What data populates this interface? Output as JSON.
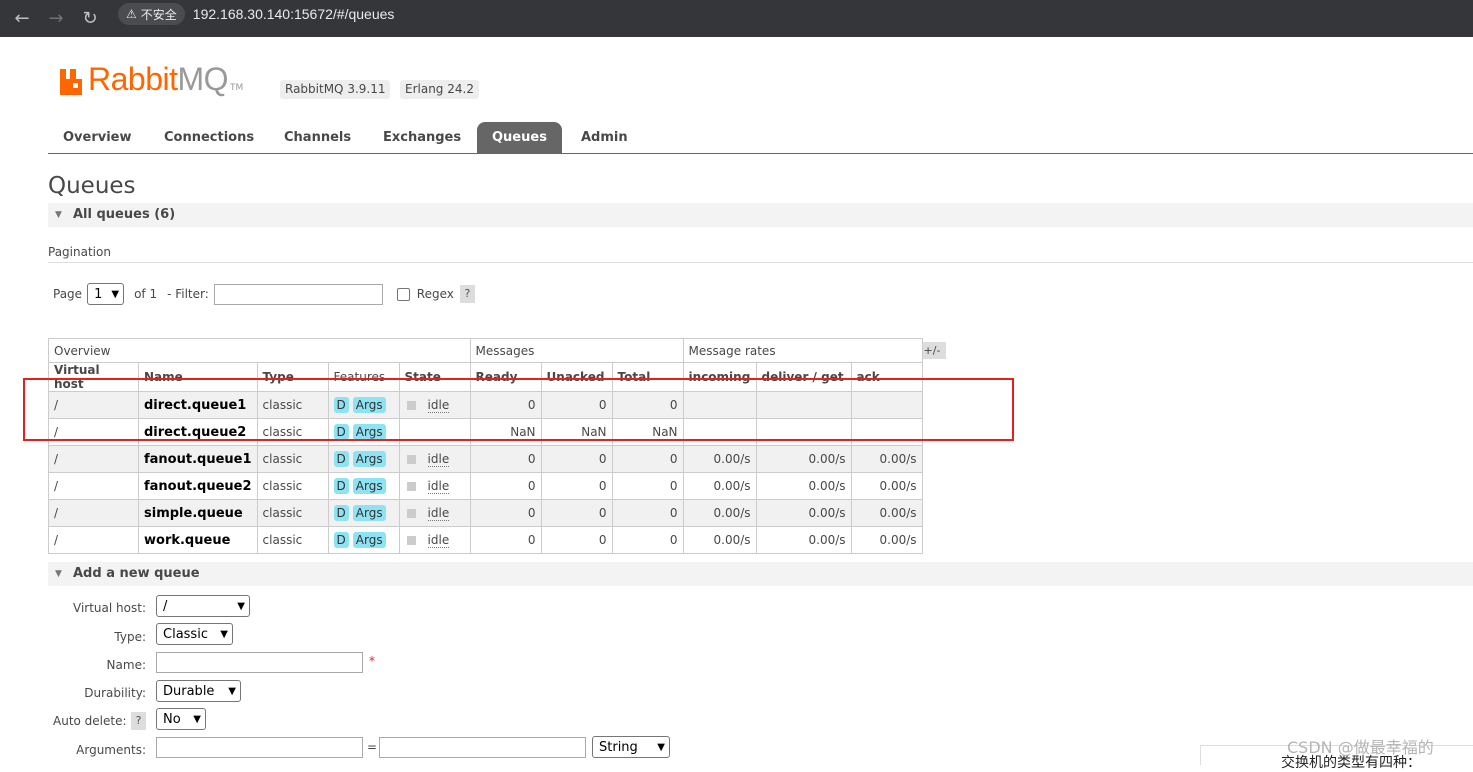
{
  "browser": {
    "security_label": "不安全",
    "url": "192.168.30.140:15672/#/queues"
  },
  "header": {
    "logo_rabbit": "Rabbit",
    "logo_mq": "MQ",
    "logo_tm": "TM",
    "version_badge": "RabbitMQ 3.9.11",
    "erlang_badge": "Erlang 24.2"
  },
  "tabs": [
    "Overview",
    "Connections",
    "Channels",
    "Exchanges",
    "Queues",
    "Admin"
  ],
  "page_title": "Queues",
  "all_queues_header": "All queues (6)",
  "pagination": {
    "label": "Pagination",
    "page_label": "Page",
    "page_value": "1",
    "of_label": "of 1",
    "filter_label": "- Filter:",
    "filter_value": "",
    "regex_label": "Regex",
    "help": "?"
  },
  "table": {
    "group_headers": [
      "Overview",
      "Messages",
      "Message rates"
    ],
    "toggle": "+/-",
    "columns": [
      "Virtual host",
      "Name",
      "Type",
      "Features",
      "State",
      "Ready",
      "Unacked",
      "Total",
      "incoming",
      "deliver / get",
      "ack"
    ],
    "feature_d": "D",
    "feature_args": "Args",
    "rows": [
      {
        "vhost": "/",
        "name": "direct.queue1",
        "type": "classic",
        "state": "idle",
        "ready": "0",
        "unacked": "0",
        "total": "0",
        "incoming": "",
        "deliver": "",
        "ack": ""
      },
      {
        "vhost": "/",
        "name": "direct.queue2",
        "type": "classic",
        "state": "",
        "ready": "NaN",
        "unacked": "NaN",
        "total": "NaN",
        "incoming": "",
        "deliver": "",
        "ack": ""
      },
      {
        "vhost": "/",
        "name": "fanout.queue1",
        "type": "classic",
        "state": "idle",
        "ready": "0",
        "unacked": "0",
        "total": "0",
        "incoming": "0.00/s",
        "deliver": "0.00/s",
        "ack": "0.00/s"
      },
      {
        "vhost": "/",
        "name": "fanout.queue2",
        "type": "classic",
        "state": "idle",
        "ready": "0",
        "unacked": "0",
        "total": "0",
        "incoming": "0.00/s",
        "deliver": "0.00/s",
        "ack": "0.00/s"
      },
      {
        "vhost": "/",
        "name": "simple.queue",
        "type": "classic",
        "state": "idle",
        "ready": "0",
        "unacked": "0",
        "total": "0",
        "incoming": "0.00/s",
        "deliver": "0.00/s",
        "ack": "0.00/s"
      },
      {
        "vhost": "/",
        "name": "work.queue",
        "type": "classic",
        "state": "idle",
        "ready": "0",
        "unacked": "0",
        "total": "0",
        "incoming": "0.00/s",
        "deliver": "0.00/s",
        "ack": "0.00/s"
      }
    ]
  },
  "add_queue": {
    "header": "Add a new queue",
    "vhost_label": "Virtual host:",
    "vhost_value": "/",
    "type_label": "Type:",
    "type_value": "Classic",
    "name_label": "Name:",
    "name_value": "",
    "required_mark": "*",
    "durability_label": "Durability:",
    "durability_value": "Durable",
    "autodelete_label": "Auto delete:",
    "autodelete_help": "?",
    "autodelete_value": "No",
    "arguments_label": "Arguments:",
    "arguments_eq": "=",
    "arguments_type": "String"
  },
  "overlay": {
    "watermark": "CSDN @做最幸福的",
    "popup_text": "交换机的类型有四种："
  },
  "colors": {
    "rabbit_orange": "#ff6600",
    "active_tab": "#666666",
    "highlight_box": "#e0231c",
    "feature_badge": "#8de2f4"
  }
}
